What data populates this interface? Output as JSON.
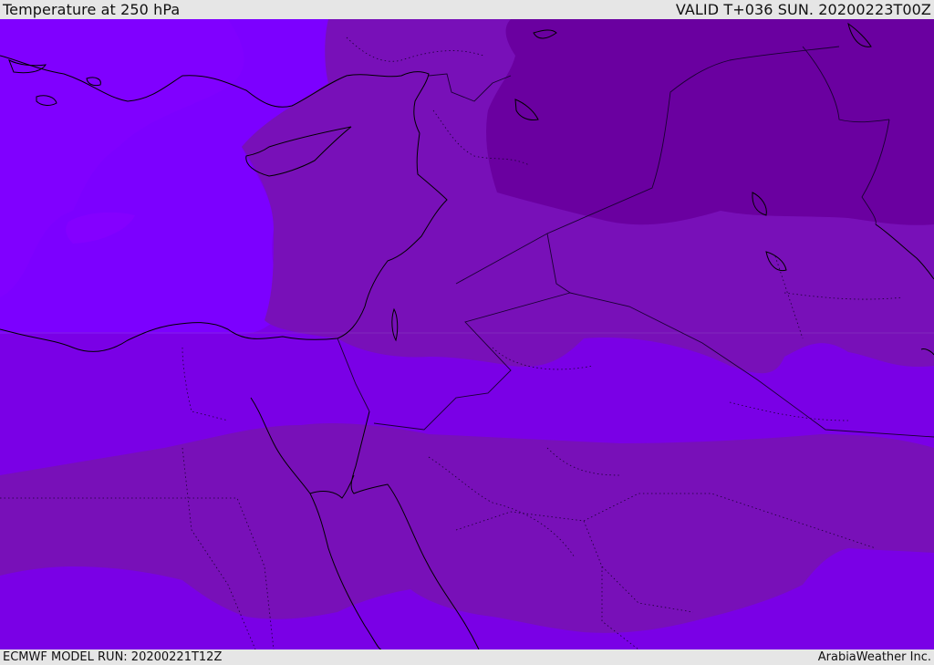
{
  "header": {
    "title": "Temperature at 250 hPa",
    "valid": "VALID T+036 SUN. 20200223T00Z"
  },
  "footer": {
    "model_run": "ECMWF MODEL RUN: 20200221T12Z",
    "provider": "ArabiaWeather Inc."
  },
  "colors": {
    "warmest_band": "#7c00ff",
    "warm_band": "#7a00e6",
    "mid_band": "#7810b8",
    "cold_band": "#6a00a0",
    "coastline": "#000000",
    "border": "#1a0033"
  }
}
